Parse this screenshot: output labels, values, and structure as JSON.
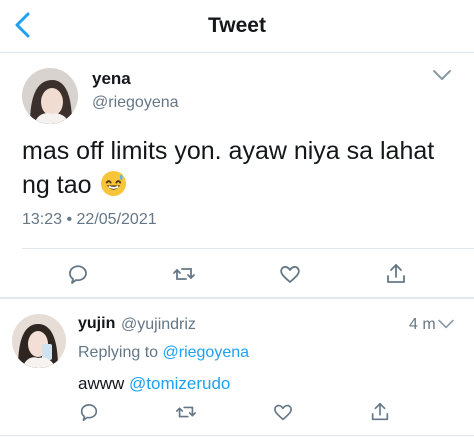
{
  "header": {
    "title": "Tweet",
    "back_icon": "chevron-left-icon"
  },
  "colors": {
    "accent": "#1da1f2",
    "secondary_text": "#657786",
    "divider": "#e1e8ed"
  },
  "main_tweet": {
    "name": "yena",
    "handle": "@riegoyena",
    "text": "mas off limits yon. ayaw niya sa lahat ng tao",
    "emoji_icon": "grinning-sweat-emoji-icon",
    "timestamp": "13:23 • 22/05/2021",
    "actions": [
      "reply-icon",
      "retweet-icon",
      "like-icon",
      "share-icon"
    ]
  },
  "reply_tweet": {
    "name": "yujin",
    "handle": "@yujindriz",
    "time": "4 m",
    "replying_prefix": "Replying to ",
    "replying_to": "@riegoyena",
    "text_prefix": "awww ",
    "mention": "@tomizerudo",
    "actions": [
      "reply-icon",
      "retweet-icon",
      "like-icon",
      "share-icon"
    ]
  }
}
